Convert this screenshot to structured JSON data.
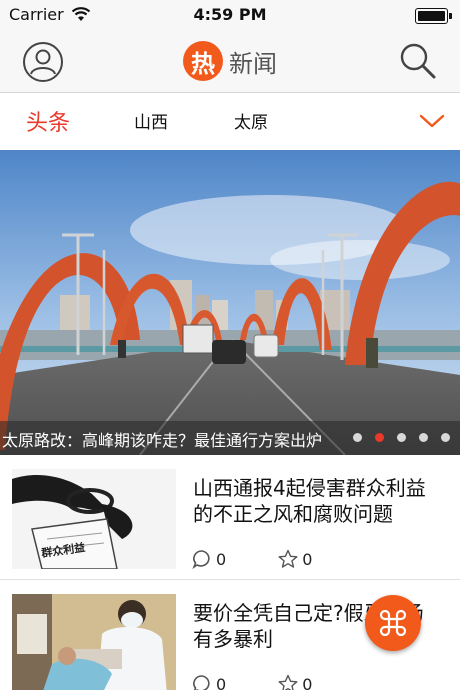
{
  "status_bar": {
    "carrier": "Carrier",
    "time": "4:59 PM",
    "battery_level": 1.0
  },
  "nav": {
    "logo_char": "热",
    "title": "新闻",
    "profile_icon": "user-circle-icon",
    "search_icon": "search-icon"
  },
  "tabs": [
    {
      "label": "头条",
      "active": true
    },
    {
      "label": "山西",
      "active": false
    },
    {
      "label": "太原",
      "active": false
    }
  ],
  "hero": {
    "caption": "太原路改：高峰期该咋走？最佳通行方案出炉",
    "dots_total": 5,
    "dots_active_index": 1
  },
  "news": [
    {
      "title": "山西通报4起侵害群众利益的不正之风和腐败问题",
      "comments": "0",
      "stars": "0",
      "thumb_label": "群众利益"
    },
    {
      "title": "要价全凭自己定?假牙市场有多暴利",
      "comments": "0",
      "stars": "0"
    }
  ],
  "colors": {
    "accent": "#e8392b",
    "brand": "#f25a1c",
    "bar_bg": "#f7f7f7"
  }
}
